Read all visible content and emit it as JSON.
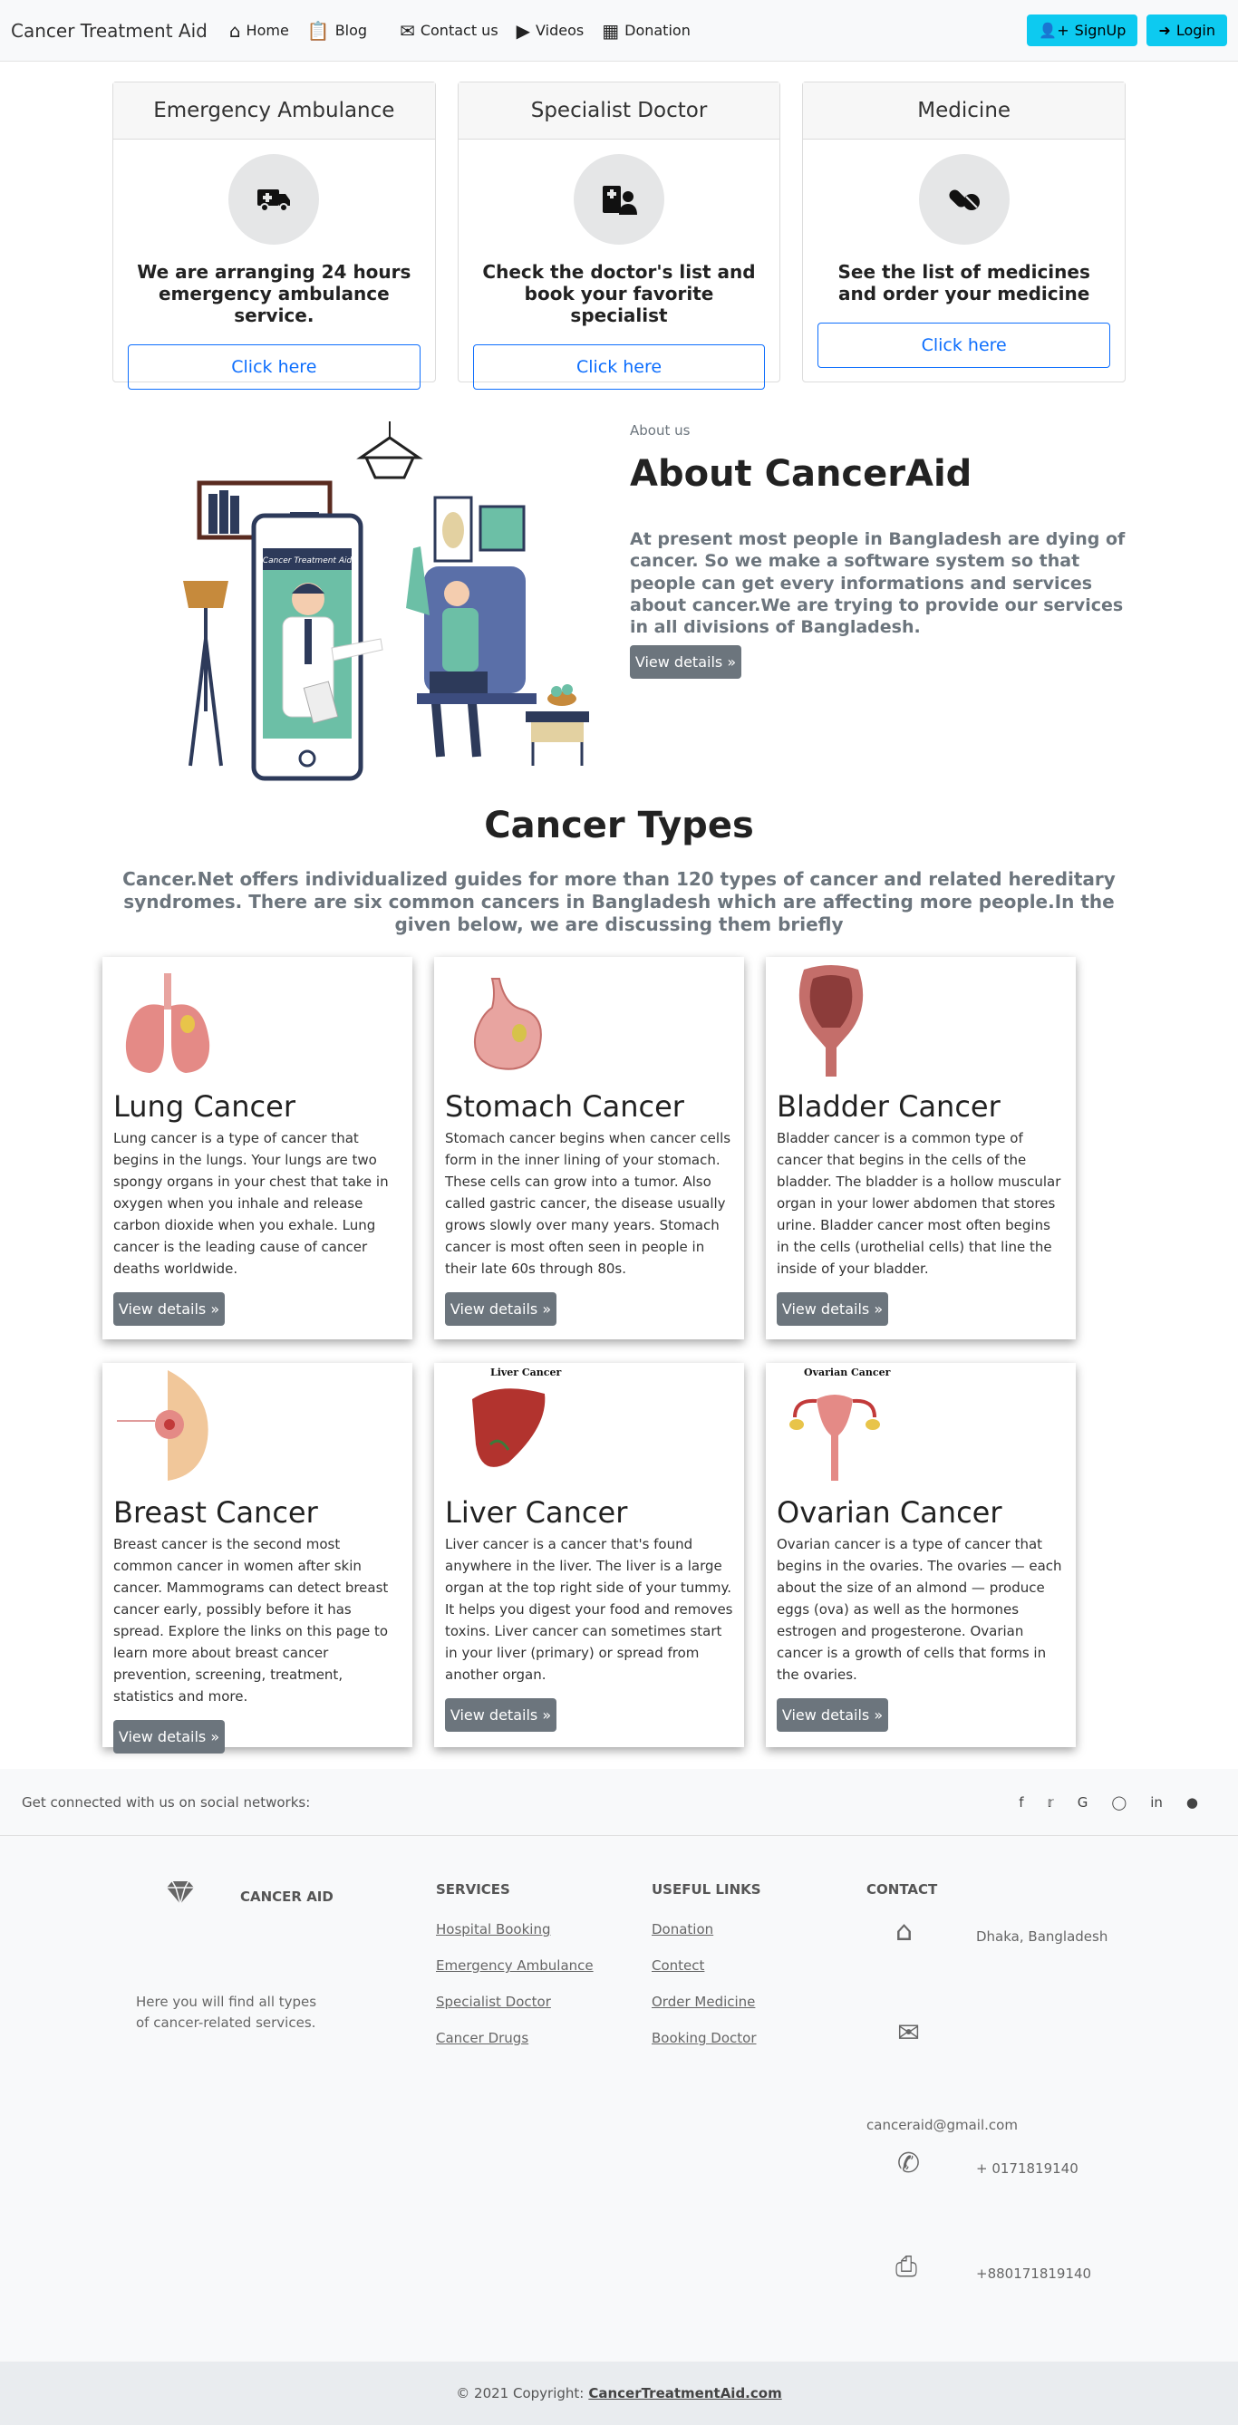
{
  "nav": {
    "brand": "Cancer Treatment Aid",
    "links": [
      {
        "label": "Home",
        "icon": "home-icon"
      },
      {
        "label": "Blog",
        "icon": "clipboard-icon"
      },
      {
        "label": "Contact us",
        "icon": "envelope-icon"
      },
      {
        "label": "Videos",
        "icon": "play-circle-icon"
      },
      {
        "label": "Donation",
        "icon": "cash-register-icon"
      }
    ],
    "signup": "SignUp",
    "login": "Login"
  },
  "services": [
    {
      "title": "Emergency Ambulance",
      "text": "We are arranging 24 hours emergency ambulance service.",
      "button": "Click here",
      "icon": "ambulance-icon"
    },
    {
      "title": "Specialist Doctor",
      "text": "Check the doctor's list and book your favorite specialist",
      "button": "Click here",
      "icon": "hospital-user-icon"
    },
    {
      "title": "Medicine",
      "text": "See the list of medicines and order your medicine",
      "button": "Click here",
      "icon": "pills-icon"
    }
  ],
  "about": {
    "small": "About us",
    "title": "About CancerAid",
    "text": "At present most people in Bangladesh are dying of cancer. So we make a software system so that people can get every informations and services about cancer.We are trying to provide our services in all divisions of Bangladesh.",
    "button": "View details »",
    "phone_label": "Cancer Treatment Aid"
  },
  "types": {
    "title": "Cancer Types",
    "subtitle": "Cancer.Net offers individualized guides for more than 120 types of cancer and related hereditary syndromes. There are six common cancers in Bangladesh which are affecting more people.In the given below, we are discussing them briefly",
    "cards": [
      {
        "title": "Lung Cancer",
        "text": "Lung cancer is a type of cancer that begins in the lungs. Your lungs are two spongy organs in your chest that take in oxygen when you inhale and release carbon dioxide when you exhale. Lung cancer is the leading cause of cancer deaths worldwide.",
        "button": "View details »"
      },
      {
        "title": "Stomach Cancer",
        "text": "Stomach cancer begins when cancer cells form in the inner lining of your stomach. These cells can grow into a tumor. Also called gastric cancer, the disease usually grows slowly over many years. Stomach cancer is most often seen in people in their late 60s through 80s.",
        "button": "View details »"
      },
      {
        "title": "Bladder Cancer",
        "text": "Bladder cancer is a common type of cancer that begins in the cells of the bladder. The bladder is a hollow muscular organ in your lower abdomen that stores urine. Bladder cancer most often begins in the cells (urothelial cells) that line the inside of your bladder.",
        "button": "View details »"
      },
      {
        "title": "Breast Cancer",
        "text": "Breast cancer is the second most common cancer in women after skin cancer. Mammograms can detect breast cancer early, possibly before it has spread. Explore the links on this page to learn more about breast cancer prevention, screening, treatment, statistics and more.",
        "button": "View details »"
      },
      {
        "title": "Liver Cancer",
        "text": "Liver cancer is a cancer that's found anywhere in the liver. The liver is a large organ at the top right side of your tummy. It helps you digest your food and removes toxins. Liver cancer can sometimes start in your liver (primary) or spread from another organ.",
        "button": "View details »",
        "img_label": "Liver Cancer"
      },
      {
        "title": "Ovarian Cancer",
        "text": "Ovarian cancer is a type of cancer that begins in the ovaries. The ovaries — each about the size of an almond — produce eggs (ova) as well as the hormones estrogen and progesterone. Ovarian cancer is a growth of cells that forms in the ovaries.",
        "button": "View details »",
        "img_label": "Ovarian Cancer"
      }
    ]
  },
  "social": {
    "text": "Get connected with us on social networks:",
    "icons": [
      "facebook-icon",
      "twitter-icon",
      "google-icon",
      "instagram-icon",
      "linkedin-icon",
      "github-icon"
    ]
  },
  "footer": {
    "brand": "CANCER AID",
    "brand_text": "Here you will find all types of cancer-related services.",
    "services_title": "SERVICES",
    "services": [
      "Hospital Booking",
      "Emergency Ambulance",
      "Specialist Doctor",
      "Cancer Drugs"
    ],
    "links_title": "USEFUL LINKS",
    "links": [
      "Donation",
      "Contect",
      "Order Medicine",
      "Booking Doctor"
    ],
    "contact_title": "CONTACT",
    "address": "Dhaka, Bangladesh",
    "email": "canceraid@gmail.com",
    "phone": "+ 0171819140",
    "fax": "+880171819140"
  },
  "copyright": {
    "text": "© 2021 Copyright:",
    "link": "CancerTreatmentAid.com"
  }
}
